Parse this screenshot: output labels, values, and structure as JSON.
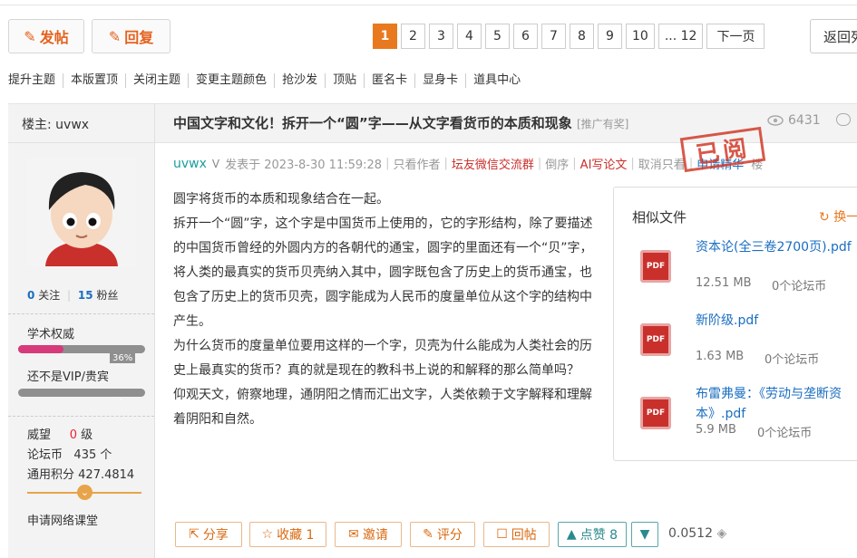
{
  "toolbar": {
    "post_label": "发帖",
    "reply_label": "回复",
    "back_label": "返回列"
  },
  "pager": {
    "pages": [
      "1",
      "2",
      "3",
      "4",
      "5",
      "6",
      "7",
      "8",
      "9",
      "10",
      "... 12"
    ],
    "next": "下一页"
  },
  "admin_tools": [
    "提升主题",
    "本版置顶",
    "关闭主题",
    "变更主题颜色",
    "抢沙发",
    "顶贴",
    "匿名卡",
    "显身卡",
    "道具中心"
  ],
  "thread": {
    "owner_label": "楼主: uvwx",
    "title": "中国文字和文化！拆开一个“圆”字——从文字看货币的本质和现象",
    "tag": "[推广有奖]",
    "views": "6431"
  },
  "author": {
    "name": "uvwx",
    "posted": "发表于 2023-8-30 11:59:28",
    "only_author": "只看作者",
    "wechat": "坛友微信交流群",
    "reverse": "倒序",
    "ai": "AI写论文",
    "take": "取消只看",
    "apply_essence": "申请精华",
    "floor": "楼",
    "stamp": "已阅"
  },
  "profile": {
    "follow_count": "0",
    "follow_label": "关注",
    "fans_count": "15",
    "fans_label": "粉丝",
    "rank1": "学术权威",
    "rank1_pct": "36%",
    "rank1_value": 0.36,
    "rank2": "还不是VIP/贵宾",
    "rank2_value": "-",
    "weiwang_label": "威望",
    "weiwang_value": "0",
    "weiwang_unit": "级",
    "coin_label": "论坛币",
    "coin_value": "435 个",
    "points_label": "通用积分",
    "points_value": "427.4814",
    "course": "申请网络课堂"
  },
  "post": {
    "paragraphs": [
      "圆字将货币的本质和现象结合在一起。",
      "拆开一个“圆”字，这个字是中国货币上使用的，它的字形结构，除了要描述的中国货币曾经的外圆内方的各朝代的通宝，圆字的里面还有一个“贝”字，将人类的最真实的货币贝壳纳入其中，圆字既包含了历史上的货币通宝，也包含了历史上的货币贝壳，圆字能成为人民币的度量单位从这个字的结构中产生。",
      "为什么货币的度量单位要用这样的一个字，贝壳为什么能成为人类社会的历史上最真实的货币？真的就是现在的教科书上说的和解释的那么简单吗？",
      "仰观天文，俯察地理，通阴阳之情而汇出文字，人类依赖于文字解释和理解着阴阳和自然。"
    ]
  },
  "similar": {
    "title": "相似文件",
    "refresh": "换一",
    "files": [
      {
        "name": "资本论(全三卷2700页).pdf",
        "size": "12.51 MB",
        "coins": "0个论坛币"
      },
      {
        "name": "新阶级.pdf",
        "size": "1.63 MB",
        "coins": "0个论坛币"
      },
      {
        "name": "布雷弗曼：《劳动与垄断资本》.pdf",
        "size": "5.9 MB",
        "coins": "0个论坛币"
      }
    ]
  },
  "actions": {
    "share": "分享",
    "favorite": "收藏 1",
    "invite": "邀请",
    "rate": "评分",
    "reply": "回帖",
    "like": "点赞 8",
    "score": "0.0512"
  },
  "colors": {
    "accent": "#e8791e",
    "link": "#1a6ec1",
    "red": "#c9302c",
    "teal": "#2b8a8d"
  }
}
